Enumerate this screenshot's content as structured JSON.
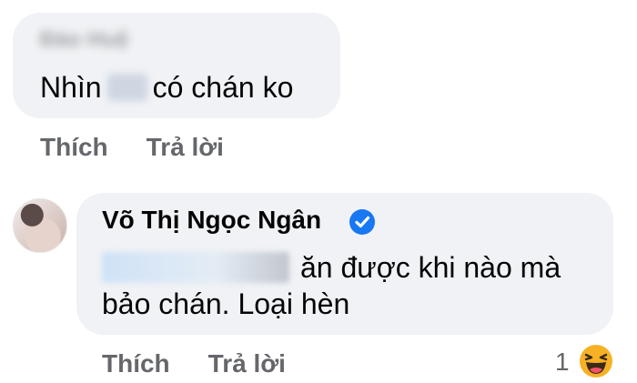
{
  "comment": {
    "author": "Đào Huệ",
    "text_before": "Nhìn",
    "text_hidden": "vợ",
    "text_after": "có chán ko",
    "like_label": "Thích",
    "reply_label": "Trả lời"
  },
  "reply": {
    "author": "Võ Thị Ngọc Ngân",
    "verified": "verified-badge-icon",
    "line1_after": "ăn được khi nào mà",
    "line2": "bảo chán. Loại hèn",
    "like_label": "Thích",
    "reply_label": "Trả lời",
    "reaction_count": "1",
    "reaction_icon": "haha-emoji-icon"
  },
  "colors": {
    "bubble": "#f0f2f5",
    "action_text": "#65676b",
    "verified": "#1877f2",
    "haha": "#f7b125"
  }
}
